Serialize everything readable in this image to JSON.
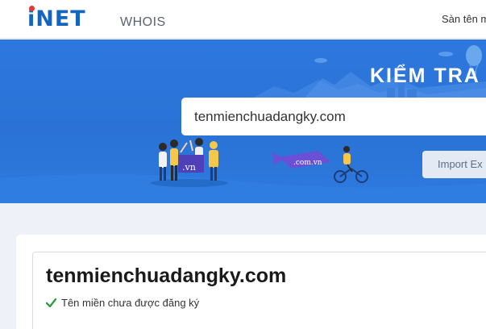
{
  "header": {
    "logo_text_i": "i",
    "logo_text_net": "NET",
    "section": "WHOIS",
    "nav_link": "Sàn tên m"
  },
  "banner": {
    "title": "KIỂM TRA T",
    "search_value": "tenmienchuadangky.com",
    "import_button": "Import Ex",
    "flag_vn": ".vn",
    "flag_comvn": ".com.vn"
  },
  "result": {
    "domain": "tenmienchuadangky.com",
    "status": "Tên miền chưa được đăng ký",
    "status_color": "#2e9e44"
  },
  "colors": {
    "brand_blue": "#1565c0",
    "brand_red": "#e53935",
    "banner_blue": "#2a72d6"
  }
}
